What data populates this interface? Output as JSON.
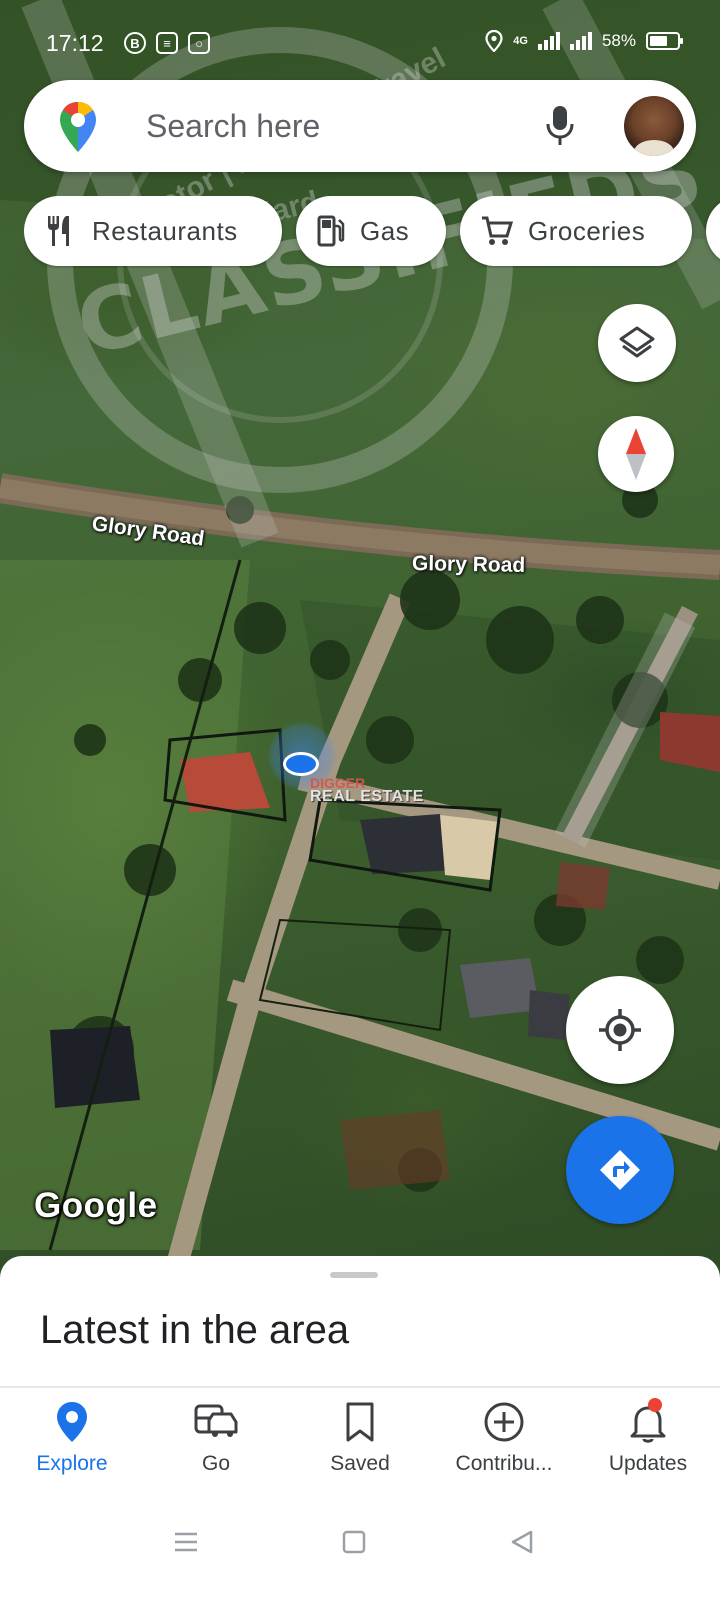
{
  "status_bar": {
    "time": "17:12",
    "network": "4G",
    "battery": "58%",
    "notif_icons": [
      "b-icon",
      "news-icon",
      "instagram-icon"
    ]
  },
  "search": {
    "placeholder": "Search here"
  },
  "chips": [
    {
      "label": "Restaurants",
      "icon": "fork-knife-icon"
    },
    {
      "label": "Gas",
      "icon": "gas-pump-icon"
    },
    {
      "label": "Groceries",
      "icon": "cart-icon"
    }
  ],
  "map": {
    "road_labels": [
      "Glory Road",
      "Glory Road"
    ],
    "attribution": "Google",
    "watermark": {
      "top": "Motor | Property | Travel",
      "middle": "Standard",
      "main": "CLASSIFIEDS",
      "brand_line1": "DIGGER",
      "brand_line2": "REAL ESTATE"
    }
  },
  "sheet": {
    "title": "Latest in the area"
  },
  "nav": {
    "items": [
      {
        "label": "Explore",
        "active": true
      },
      {
        "label": "Go",
        "active": false
      },
      {
        "label": "Saved",
        "active": false
      },
      {
        "label": "Contribu...",
        "active": false
      },
      {
        "label": "Updates",
        "active": false
      }
    ]
  },
  "colors": {
    "accent": "#1a73e8",
    "badge": "#ea4335"
  }
}
